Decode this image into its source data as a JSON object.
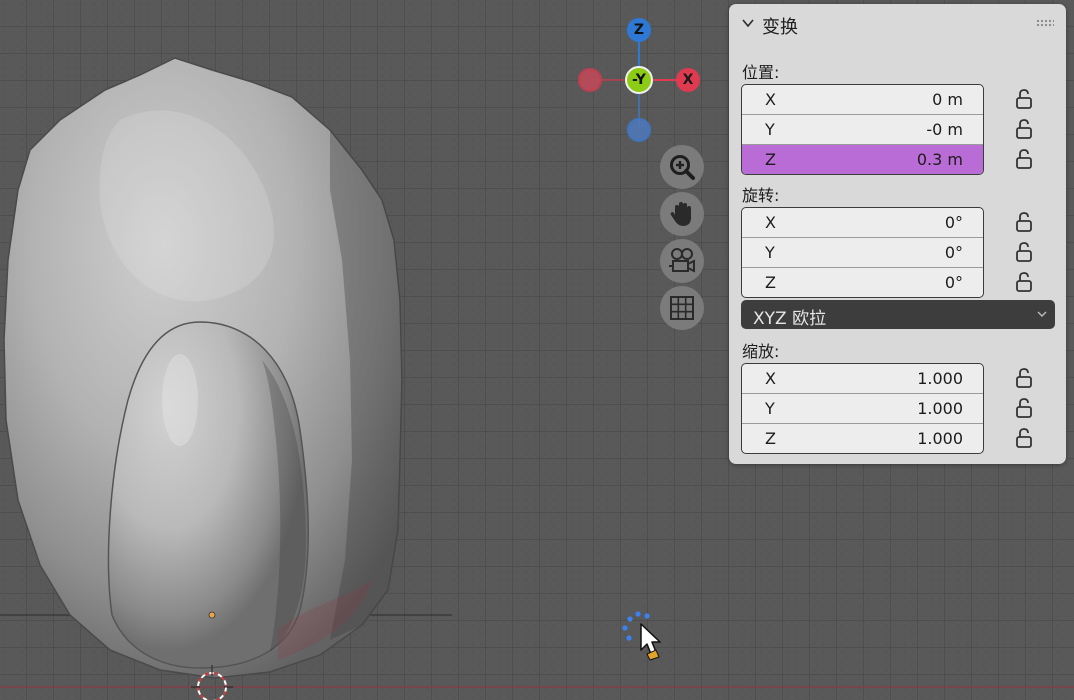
{
  "gizmo": {
    "z_label": "Z",
    "neg_y_label": "-Y",
    "x_label": "X",
    "colors": {
      "z": "#2f79d6",
      "neg_y": "#8dcc15",
      "x": "#e03a50",
      "neg_x_ring": "#cc3c4f",
      "neg_z_ring": "#3e79c8"
    }
  },
  "nav_tools": [
    {
      "icon": "zoom-icon"
    },
    {
      "icon": "pan-hand-icon"
    },
    {
      "icon": "camera-icon"
    },
    {
      "icon": "grid-icon"
    }
  ],
  "panel": {
    "title": "变换",
    "location": {
      "label": "位置:",
      "fields": [
        {
          "axis": "X",
          "value": "0 m"
        },
        {
          "axis": "Y",
          "value": "-0 m"
        },
        {
          "axis": "Z",
          "value": "0.3 m"
        }
      ]
    },
    "rotation": {
      "label": "旋转:",
      "fields": [
        {
          "axis": "X",
          "value": "0°"
        },
        {
          "axis": "Y",
          "value": "0°"
        },
        {
          "axis": "Z",
          "value": "0°"
        }
      ]
    },
    "rotation_mode": {
      "selected": "XYZ 欧拉"
    },
    "scale": {
      "label": "缩放:",
      "fields": [
        {
          "axis": "X",
          "value": "1.000"
        },
        {
          "axis": "Y",
          "value": "1.000"
        },
        {
          "axis": "Z",
          "value": "1.000"
        }
      ]
    },
    "highlight_color": "#b96bd6"
  }
}
